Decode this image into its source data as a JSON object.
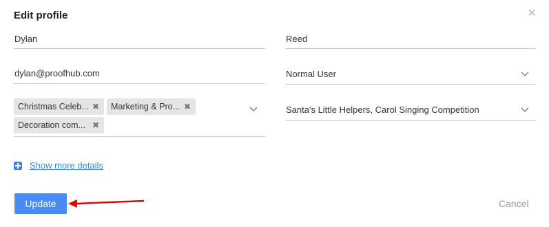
{
  "dialog": {
    "title": "Edit profile",
    "close_icon": "close-icon"
  },
  "form": {
    "first_name": "Dylan",
    "last_name": "Reed",
    "email": "dylan@proofhub.com",
    "role": "Normal User",
    "groups_tags": [
      "Christmas Celeb...",
      "Marketing & Pro...",
      "Decoration com..."
    ],
    "teams": "Santa's Little Helpers, Carol Singing Competition",
    "show_more_label": "Show more details"
  },
  "actions": {
    "update_label": "Update",
    "cancel_label": "Cancel"
  },
  "colors": {
    "accent": "#4a8af4",
    "annotation_arrow": "#e00000"
  }
}
